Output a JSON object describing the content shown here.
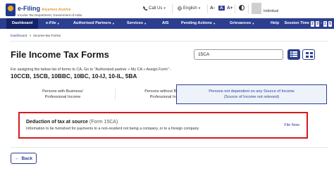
{
  "header": {
    "logo_main": "e-Filing",
    "logo_tagline": "Anywhere Anytime",
    "logo_subtitle": "Income Tax Department, Government of India",
    "call_us": "Call Us",
    "language": "English",
    "font_controls": [
      "A-",
      "A",
      "A+"
    ],
    "username": "Individual"
  },
  "nav": {
    "items": [
      {
        "label": "Dashboard",
        "active": true,
        "dropdown": false
      },
      {
        "label": "e-File",
        "active": false,
        "dropdown": true
      },
      {
        "label": "Authorised Partners",
        "active": false,
        "dropdown": true
      },
      {
        "label": "Services",
        "active": false,
        "dropdown": true
      },
      {
        "label": "AIS",
        "active": false,
        "dropdown": false
      },
      {
        "label": "Pending Actions",
        "active": false,
        "dropdown": true
      },
      {
        "label": "Grievances",
        "active": false,
        "dropdown": true
      },
      {
        "label": "Help",
        "active": false,
        "dropdown": false
      }
    ],
    "session_label": "Session Time",
    "session_digits": [
      "2",
      "3",
      "1",
      "5"
    ]
  },
  "breadcrumb": {
    "items": [
      "Dashboard",
      "Income-tax Forms"
    ]
  },
  "page": {
    "title": "File Income Tax Forms",
    "search_value": "15CA",
    "instruction": "For assigning the below list of forms to CA, Go to \"Authorized partner » My CA » Assign Form\" -",
    "form_codes": "10CCB, 15CB, 10BBC, 10BC, 10-IJ, 10-IL, 5BA"
  },
  "category_tabs": [
    {
      "label": "Persons with Business/\nProfessional Income",
      "active": false
    },
    {
      "label": "Persons without Business/\nProfessional Income",
      "active": false
    },
    {
      "label": "Persons not dependent on any Source of Income\n(Source of Income not relevant)",
      "active": true
    }
  ],
  "form_card": {
    "title": "Deduction of tax at source",
    "form_no": "(Form 15CA)",
    "description": "Information to be furnished for payments to a non-resident not being a company, or to a foreign company",
    "action": "File Now"
  },
  "back_button": {
    "label": "Back"
  },
  "colors": {
    "primary": "#2c3e8f",
    "nav_active": "#15236b",
    "highlight": "#d7191c",
    "tab_active_bg": "#eef3fb"
  }
}
